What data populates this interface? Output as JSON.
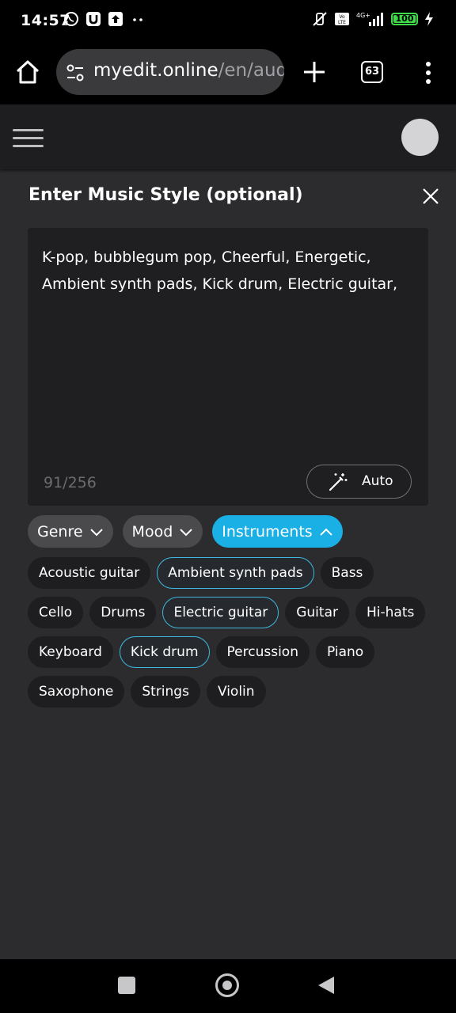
{
  "statusbar": {
    "time": "14:57",
    "battery": "100"
  },
  "browser": {
    "url_host": "myedit.online",
    "url_path": "/en/audio",
    "tab_count": "63"
  },
  "dialog": {
    "title": "Enter Music Style (optional)",
    "text_value": "K-pop, bubblegum pop, Cheerful, Energetic, Ambient synth pads, Kick drum, Electric guitar,",
    "char_count": "91/256",
    "auto_label": "Auto"
  },
  "categories": [
    {
      "label": "Genre",
      "active": false
    },
    {
      "label": "Mood",
      "active": false
    },
    {
      "label": "Instruments",
      "active": true
    }
  ],
  "instruments": [
    {
      "label": "Acoustic guitar",
      "selected": false
    },
    {
      "label": "Ambient synth pads",
      "selected": true
    },
    {
      "label": "Bass",
      "selected": false
    },
    {
      "label": "Cello",
      "selected": false
    },
    {
      "label": "Drums",
      "selected": false
    },
    {
      "label": "Electric guitar",
      "selected": true
    },
    {
      "label": "Guitar",
      "selected": false
    },
    {
      "label": "Hi-hats",
      "selected": false
    },
    {
      "label": "Keyboard",
      "selected": false
    },
    {
      "label": "Kick drum",
      "selected": true
    },
    {
      "label": "Percussion",
      "selected": false
    },
    {
      "label": "Piano",
      "selected": false
    },
    {
      "label": "Saxophone",
      "selected": false
    },
    {
      "label": "Strings",
      "selected": false
    },
    {
      "label": "Violin",
      "selected": false
    }
  ],
  "colors": {
    "accent": "#1ab0e6",
    "selected_border": "#3fb7e0",
    "background": "#2c2c2e"
  }
}
